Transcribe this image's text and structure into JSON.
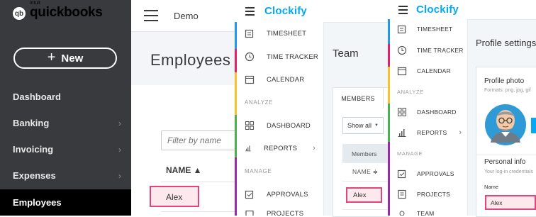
{
  "quickbooks": {
    "logo": {
      "intuit": "intuit",
      "brand": "quickbooks",
      "badge": "qb"
    },
    "new_button": "New",
    "nav": [
      {
        "label": "Dashboard",
        "chevron": false
      },
      {
        "label": "Banking",
        "chevron": true
      },
      {
        "label": "Invoicing",
        "chevron": true
      },
      {
        "label": "Expenses",
        "chevron": true
      },
      {
        "label": "Employees",
        "chevron": false,
        "active": true
      }
    ],
    "company": "Demo",
    "page_title": "Employees",
    "filter_placeholder": "Filter by name",
    "column_header": "NAME ▲",
    "rows": [
      "Alex"
    ],
    "colors": {
      "sidebar": "#393a3d",
      "active_nav": "#000000",
      "highlight_border": "#e0457b",
      "highlight_fill": "#fde8ee"
    }
  },
  "clockify_team": {
    "logo": "Clockify",
    "menu": {
      "items_top": [
        "TIMESHEET",
        "TIME TRACKER",
        "CALENDAR"
      ],
      "section_analyze": "ANALYZE",
      "items_analyze": [
        "DASHBOARD",
        "REPORTS"
      ],
      "section_manage": "MANAGE",
      "items_manage": [
        "APPROVALS",
        "PROJECTS"
      ]
    },
    "page_title": "Team",
    "tab": "MEMBERS",
    "filter": "Show all",
    "table_caption": "Members",
    "column_header": "NAME ≑",
    "rows": [
      "Alex"
    ]
  },
  "clockify_profile": {
    "logo": "Clockify",
    "menu": {
      "items_top": [
        "TIMESHEET",
        "TIME TRACKER",
        "CALENDAR"
      ],
      "section_analyze": "ANALYZE",
      "items_analyze": [
        "DASHBOARD",
        "REPORTS"
      ],
      "section_manage": "MANAGE",
      "items_manage": [
        "APPROVALS",
        "PROJECTS",
        "TEAM"
      ]
    },
    "page_title": "Profile settings",
    "profile_photo_label": "Profile photo",
    "formats_hint": "Formats: png, jpg, gif",
    "personal_info_label": "Personal info",
    "personal_info_hint": "Your log-in credentials",
    "name_label": "Name",
    "name_value": "Alex",
    "colors": {
      "accent": "#03a9f4"
    }
  }
}
